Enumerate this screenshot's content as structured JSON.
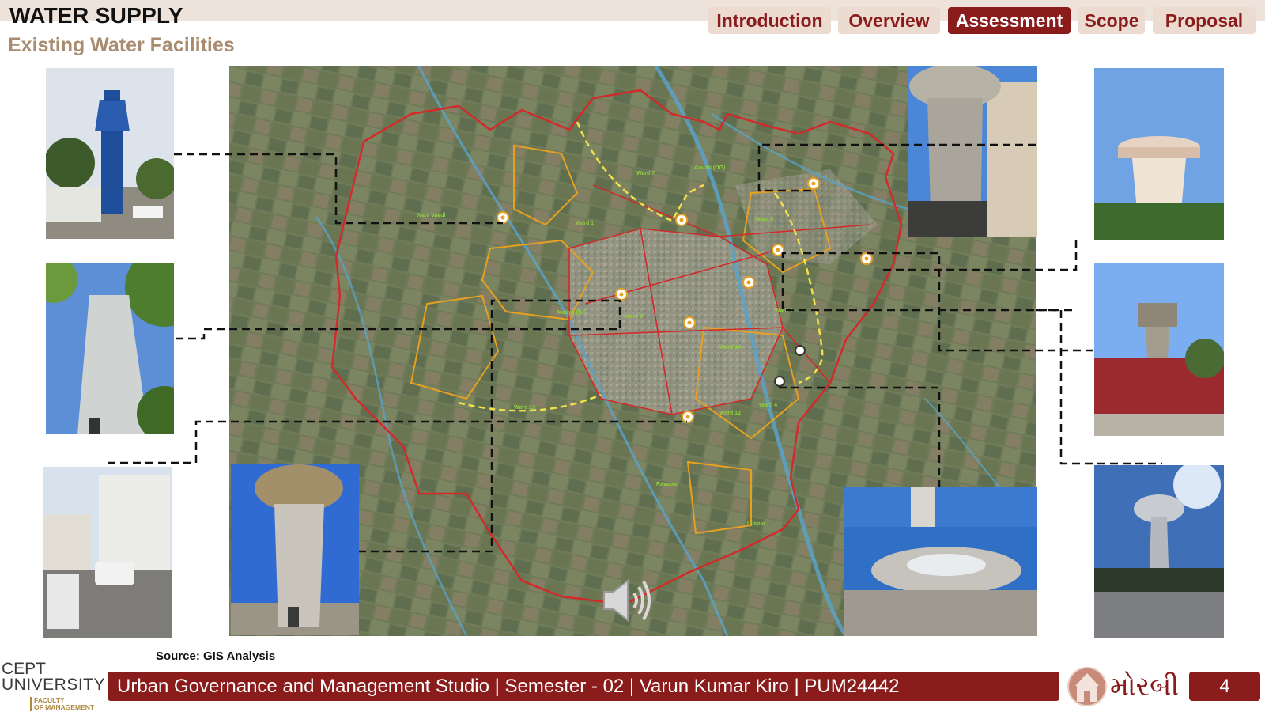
{
  "header": {
    "title": "WATER SUPPLY",
    "subtitle": "Existing Water Facilities"
  },
  "tabs": [
    {
      "label": "Introduction",
      "active": false
    },
    {
      "label": "Overview",
      "active": false
    },
    {
      "label": "Assessment",
      "active": true
    },
    {
      "label": "Scope",
      "active": false
    },
    {
      "label": "Proposal",
      "active": false
    }
  ],
  "map": {
    "labels": [
      "Ward 7",
      "Nani Vavdi",
      "Ward 1",
      "Ward 8",
      "Ward 9",
      "Ward 14",
      "Ward 3",
      "Ward 4",
      "Ward 12",
      "Ward 13",
      "Ravapar",
      "Lilapar",
      "Amreli (OG)",
      "Maliya (OG)"
    ]
  },
  "source": "Source:  GIS Analysis",
  "footer": {
    "text": "Urban Governance and Management Studio | Semester - 02 | Varun Kumar Kiro | PUM24442",
    "page": "4",
    "city_label": "મોરબી",
    "logo_line1": "CEPT",
    "logo_line2": "UNIVERSITY",
    "logo_line3a": "FACULTY",
    "logo_line3b": "OF MANAGEMENT"
  },
  "colors": {
    "accent": "#8b1c1c",
    "tab_inactive": "#ecdbd0",
    "subtitle": "#a98b6f",
    "boundary": "#d22a2a",
    "ward_boundary": "#e8a020",
    "connector": "#111111"
  },
  "icons": [
    "water-tank-marker-icon",
    "speaker-icon"
  ]
}
